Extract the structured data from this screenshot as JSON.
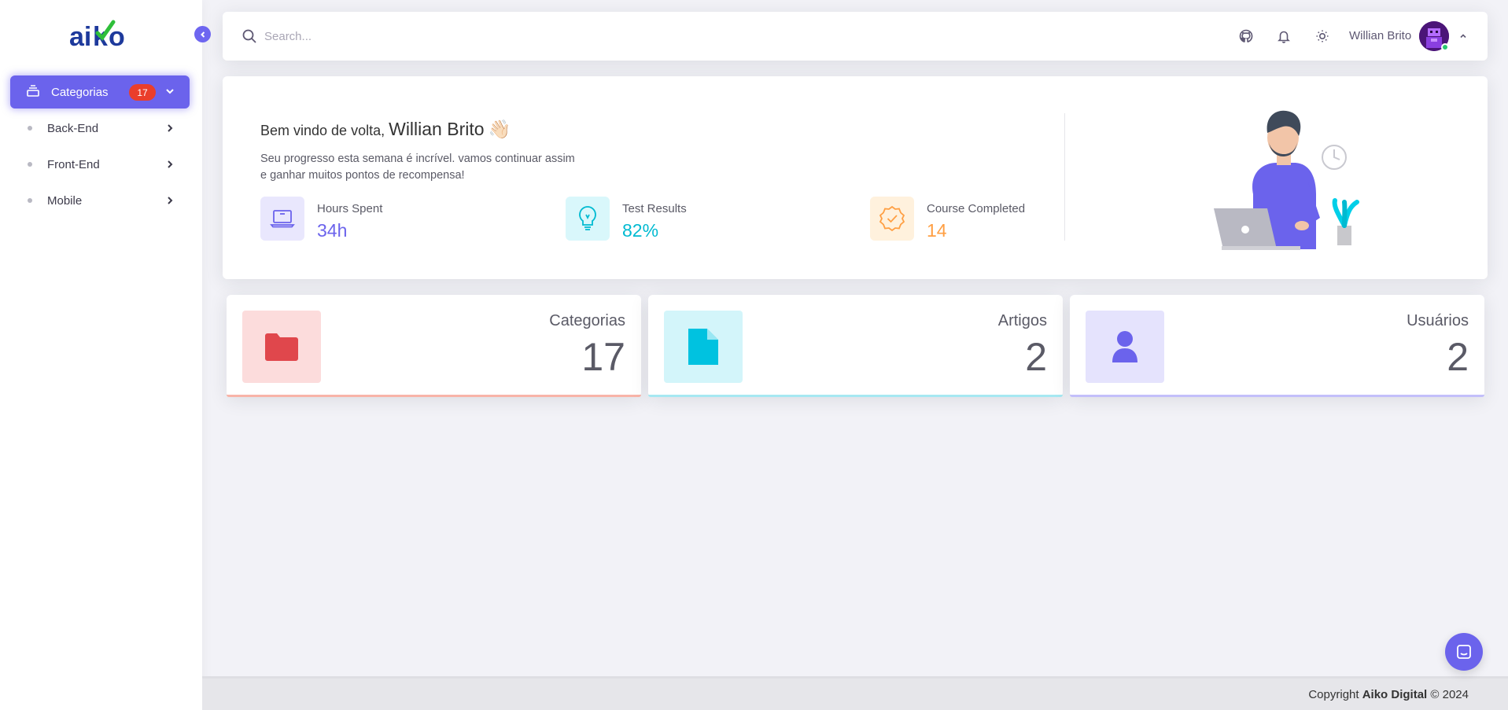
{
  "app": {
    "logo_text": "aiko"
  },
  "sidebar": {
    "active_item": {
      "label": "Categorias",
      "badge": "17",
      "icon": "layers-icon"
    },
    "items": [
      {
        "label": "Back-End"
      },
      {
        "label": "Front-End"
      },
      {
        "label": "Mobile"
      }
    ]
  },
  "navbar": {
    "search_placeholder": "Search...",
    "icons": [
      "github-icon",
      "bell-icon",
      "sun-icon"
    ],
    "user_name": "Willian Brito"
  },
  "welcome": {
    "greeting": "Bem vindo de volta,",
    "name": "Willian Brito",
    "emoji": "👋🏻",
    "message_line1": "Seu progresso esta semana é incrível. vamos continuar assim",
    "message_line2": "e ganhar muitos pontos de recompensa!",
    "stats": [
      {
        "label": "Hours Spent",
        "value": "34h",
        "color": "#6b63ec",
        "icon": "laptop-icon"
      },
      {
        "label": "Test Results",
        "value": "82%",
        "color": "#00bad1",
        "icon": "lightbulb-icon"
      },
      {
        "label": "Course Completed",
        "value": "14",
        "color": "#ff9f43",
        "icon": "badge-check-icon"
      }
    ]
  },
  "cards": [
    {
      "label": "Categorias",
      "value": "17",
      "color": "#ea5455",
      "icon": "folder-icon"
    },
    {
      "label": "Artigos",
      "value": "2",
      "color": "#00cfe8",
      "icon": "document-icon"
    },
    {
      "label": "Usuários",
      "value": "2",
      "color": "#7367f0",
      "icon": "user-icon"
    }
  ],
  "footer": {
    "copyright": "Copyright",
    "company": "Aiko Digital",
    "year": "© 2024"
  }
}
